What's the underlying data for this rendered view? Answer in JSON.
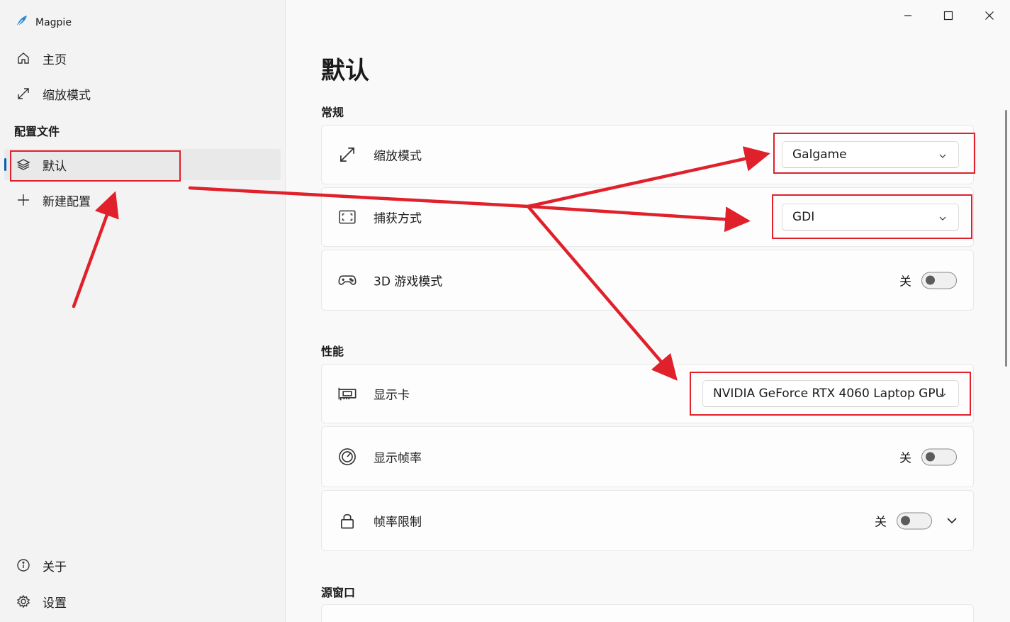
{
  "app": {
    "title": "Magpie"
  },
  "sidebar": {
    "items": [
      {
        "label": "主页",
        "icon": "home-icon"
      },
      {
        "label": "缩放模式",
        "icon": "resize-icon"
      }
    ],
    "section_label": "配置文件",
    "profiles": [
      {
        "label": "默认",
        "icon": "layers-icon",
        "selected": true
      },
      {
        "label": "新建配置",
        "icon": "plus-icon"
      }
    ],
    "footer": [
      {
        "label": "关于",
        "icon": "info-icon"
      },
      {
        "label": "设置",
        "icon": "gear-icon"
      }
    ]
  },
  "page": {
    "title": "默认",
    "sections": {
      "general": "常规",
      "performance": "性能",
      "source_window": "源窗口"
    },
    "settings": {
      "scale_mode": {
        "label": "缩放模式",
        "value": "Galgame"
      },
      "capture_method": {
        "label": "捕获方式",
        "value": "GDI"
      },
      "game_mode_3d": {
        "label": "3D 游戏模式",
        "state": "关"
      },
      "gpu": {
        "label": "显示卡",
        "value": "NVIDIA GeForce RTX 4060 Laptop GPU"
      },
      "show_fps": {
        "label": "显示帧率",
        "state": "关"
      },
      "fps_limit": {
        "label": "帧率限制",
        "state": "关"
      }
    }
  },
  "colors": {
    "accent": "#005fb8",
    "annotation": "#e0202a"
  }
}
